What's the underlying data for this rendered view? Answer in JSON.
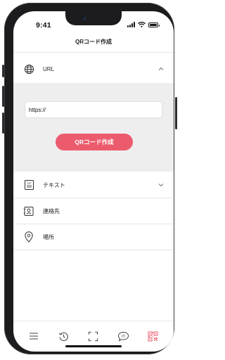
{
  "status_bar": {
    "time": "9:41"
  },
  "header": {
    "title": "QRコード作成"
  },
  "sections": [
    {
      "id": "url",
      "label": "URL",
      "icon": "globe-icon",
      "expanded": true
    },
    {
      "id": "text",
      "label": "テキスト",
      "icon": "txt-document-icon",
      "expanded": false
    },
    {
      "id": "contact",
      "label": "連絡先",
      "icon": "contact-card-icon"
    },
    {
      "id": "location",
      "label": "場所",
      "icon": "location-pin-icon"
    }
  ],
  "url_form": {
    "input_value": "https://",
    "create_button_label": "QRコード作成"
  },
  "tab_bar": {
    "tabs": [
      {
        "name": "menu",
        "icon": "hamburger-icon",
        "active": false
      },
      {
        "name": "history",
        "icon": "history-icon",
        "active": false
      },
      {
        "name": "scan",
        "icon": "scan-frame-icon",
        "active": false
      },
      {
        "name": "chat",
        "icon": "chat-ch-icon",
        "active": false
      },
      {
        "name": "create",
        "icon": "qr-code-icon",
        "active": true
      }
    ]
  },
  "colors": {
    "accent": "#ec5b6d",
    "panel_bg": "#eeeeee",
    "text": "#222222"
  }
}
